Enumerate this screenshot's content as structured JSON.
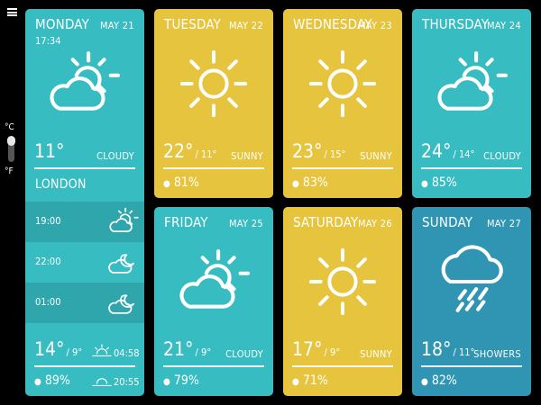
{
  "units": {
    "celsius": "°C",
    "fahrenheit": "°F"
  },
  "today": {
    "day": "MONDAY",
    "date": "MAY 21",
    "time": "17:34",
    "temp": "11°",
    "condition": "CLOUDY",
    "city": "LONDON",
    "icon": "sun-cloud-icon",
    "hourly": [
      {
        "time": "19:00",
        "icon": "sun-cloud-icon"
      },
      {
        "time": "22:00",
        "icon": "moon-cloud-icon"
      },
      {
        "time": "01:00",
        "icon": "moon-cloud-icon"
      }
    ],
    "hi": "14°",
    "lo": "/ 9°",
    "humidity": "89%",
    "sunrise": "04:58",
    "sunset": "20:55"
  },
  "forecast": [
    {
      "day": "TUESDAY",
      "date": "MAY 22",
      "hi": "22°",
      "lo": "/ 11°",
      "condition": "SUNNY",
      "humidity": "81%",
      "icon": "sun-icon"
    },
    {
      "day": "WEDNESDAY",
      "date": "MAY 23",
      "hi": "23°",
      "lo": "/ 15°",
      "condition": "SUNNY",
      "humidity": "83%",
      "icon": "sun-icon"
    },
    {
      "day": "THURSDAY",
      "date": "MAY 24",
      "hi": "24°",
      "lo": "/ 14°",
      "condition": "CLOUDY",
      "humidity": "85%",
      "icon": "sun-cloud-icon"
    },
    {
      "day": "FRIDAY",
      "date": "MAY 25",
      "hi": "21°",
      "lo": "/ 9°",
      "condition": "CLOUDY",
      "humidity": "79%",
      "icon": "sun-cloud-icon"
    },
    {
      "day": "SATURDAY",
      "date": "MAY 26",
      "hi": "17°",
      "lo": "/ 9°",
      "condition": "SUNNY",
      "humidity": "71%",
      "icon": "sun-icon"
    },
    {
      "day": "SUNDAY",
      "date": "MAY 27",
      "hi": "18°",
      "lo": "/ 11°",
      "condition": "SHOWERS",
      "humidity": "82%",
      "icon": "rain-cloud-icon"
    }
  ],
  "colors": {
    "teal": "#36bcc1",
    "yellow": "#e7c43e",
    "blue": "#2f95b3",
    "background": "#000000"
  }
}
